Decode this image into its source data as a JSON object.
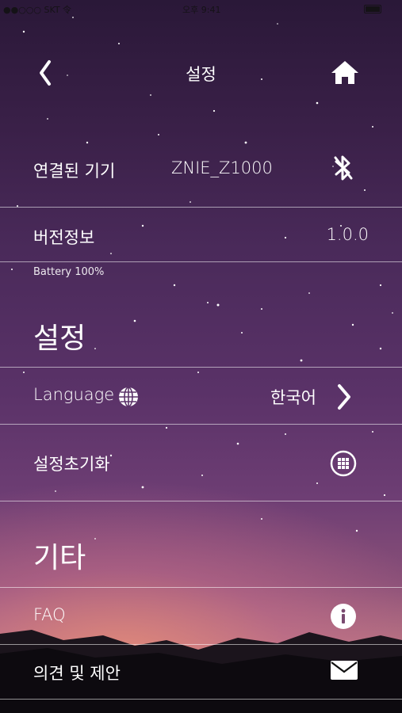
{
  "status_bar": {
    "left": "●●○○○ SKT 令",
    "center": "오후 9:41"
  },
  "nav": {
    "title": "설정"
  },
  "device": {
    "label": "연결된 기기",
    "value": "ZNIE_Z1000"
  },
  "version": {
    "label": "버전정보",
    "value": "1.0.0"
  },
  "battery": "Battery 100%",
  "settings_section": {
    "title": "설정"
  },
  "language": {
    "label": "Language",
    "value": "한국어"
  },
  "reset": {
    "label": "설정초기화"
  },
  "other_section": {
    "title": "기타"
  },
  "faq": {
    "label": "FAQ"
  },
  "feedback": {
    "label": "의견 및 제안"
  },
  "icons": {
    "back": "chevron-left-icon",
    "home": "home-icon",
    "bluetooth": "bluetooth-icon",
    "globe": "globe-icon",
    "chevron": "chevron-right-icon",
    "reset": "reset-grid-icon",
    "info": "info-icon",
    "mail": "mail-icon"
  }
}
